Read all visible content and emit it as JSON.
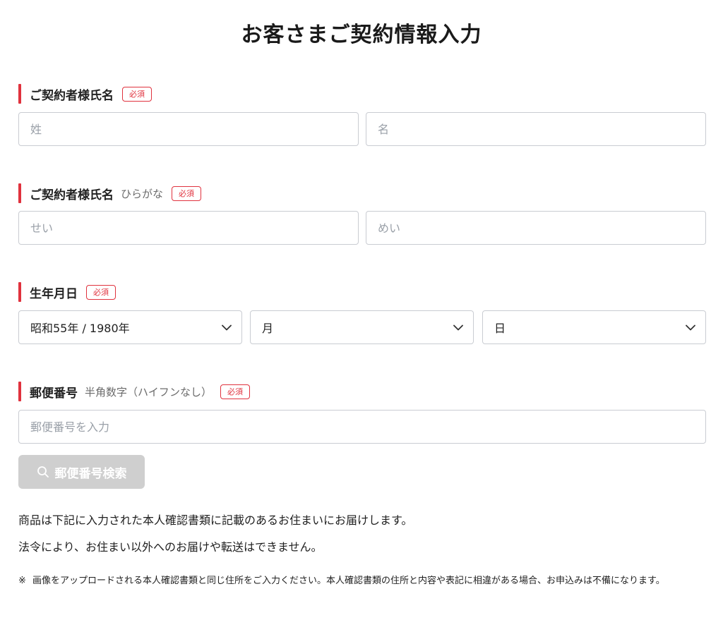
{
  "page": {
    "title": "お客さまご契約情報入力"
  },
  "name_section": {
    "label": "ご契約者様氏名",
    "required_badge": "必須",
    "last_name_placeholder": "姓",
    "first_name_placeholder": "名"
  },
  "kana_section": {
    "label": "ご契約者様氏名",
    "sublabel": "ひらがな",
    "required_badge": "必須",
    "last_name_placeholder": "せい",
    "first_name_placeholder": "めい"
  },
  "birthdate_section": {
    "label": "生年月日",
    "required_badge": "必須",
    "year_value": "昭和55年 / 1980年",
    "month_value": "月",
    "day_value": "日",
    "chevron_icon": "chevron-down-icon"
  },
  "postal_section": {
    "label": "郵便番号",
    "sublabel": "半角数字（ハイフンなし）",
    "required_badge": "必須",
    "input_placeholder": "郵便番号を入力",
    "search_button_label": "郵便番号検索",
    "search_icon": "search-icon"
  },
  "notices": {
    "line1": "商品は下記に入力された本人確認書類に記載のあるお住まいにお届けします。",
    "line2": "法令により、お住まい以外へのお届けや転送はできません。",
    "footnote_mark": "※",
    "footnote": "画像をアップロードされる本人確認書類と同じ住所をご入力ください。本人確認書類の住所と内容や表記に相違がある場合、お申込みは不備になります。"
  },
  "colors": {
    "accent": "#e0323e",
    "border": "#c9ccd2",
    "disabled_button": "#cfcfcf",
    "placeholder": "#9aa0a8"
  }
}
